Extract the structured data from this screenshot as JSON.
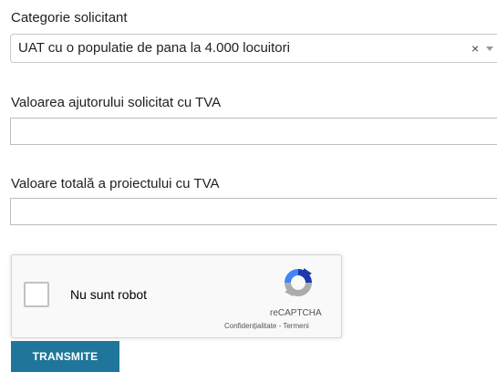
{
  "form": {
    "category_label": "Categorie solicitant",
    "category_value": "UAT cu o populatie de pana la 4.000 locuitori",
    "category_clear": "×",
    "aid_label": "Valoarea ajutorului solicitat cu TVA",
    "aid_value": "",
    "total_label": "Valoare totală a proiectului cu TVA",
    "total_value": "",
    "submit_label": "TRANSMITE"
  },
  "recaptcha": {
    "checkbox_label": "Nu sunt robot",
    "brand": "reCAPTCHA",
    "links": "Confidențialitate - Termeni"
  },
  "colors": {
    "submit_bg": "#20769a",
    "recaptcha_blue": "#1c3aa9",
    "recaptcha_light_blue": "#4285f4",
    "recaptcha_gray": "#ababab"
  }
}
